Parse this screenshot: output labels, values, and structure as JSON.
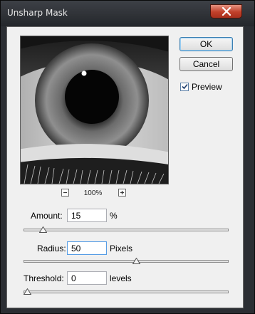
{
  "window": {
    "title": "Unsharp Mask",
    "close_icon": "close-icon"
  },
  "buttons": {
    "ok": "OK",
    "cancel": "Cancel"
  },
  "preview": {
    "label": "Preview",
    "checked": true
  },
  "zoom": {
    "level": "100%",
    "minus_icon": "zoom-out-icon",
    "plus_icon": "zoom-in-icon"
  },
  "amount": {
    "label": "Amount:",
    "value": "15",
    "unit": "%",
    "slider_fraction": 0.08
  },
  "radius": {
    "label": "Radius:",
    "value": "50",
    "unit": "Pixels",
    "slider_fraction": 0.55
  },
  "threshold": {
    "label": "Threshold:",
    "value": "0",
    "unit": "levels",
    "slider_fraction": 0.0
  },
  "colors": {
    "accent": "#3c7fb1",
    "title_bar": "#2b2e33",
    "close_button": "#c1402a",
    "dialog_bg": "#f0f0f0"
  }
}
